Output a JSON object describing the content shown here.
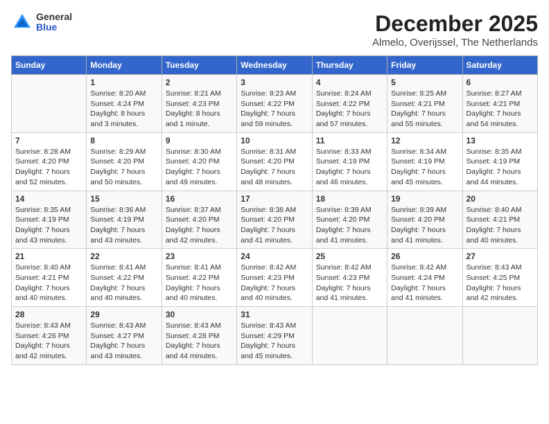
{
  "header": {
    "logo": {
      "general": "General",
      "blue": "Blue"
    },
    "title": "December 2025",
    "subtitle": "Almelo, Overijssel, The Netherlands"
  },
  "calendar": {
    "weekdays": [
      "Sunday",
      "Monday",
      "Tuesday",
      "Wednesday",
      "Thursday",
      "Friday",
      "Saturday"
    ],
    "weeks": [
      [
        {
          "day": "",
          "detail": ""
        },
        {
          "day": "1",
          "detail": "Sunrise: 8:20 AM\nSunset: 4:24 PM\nDaylight: 8 hours\nand 3 minutes."
        },
        {
          "day": "2",
          "detail": "Sunrise: 8:21 AM\nSunset: 4:23 PM\nDaylight: 8 hours\nand 1 minute."
        },
        {
          "day": "3",
          "detail": "Sunrise: 8:23 AM\nSunset: 4:22 PM\nDaylight: 7 hours\nand 59 minutes."
        },
        {
          "day": "4",
          "detail": "Sunrise: 8:24 AM\nSunset: 4:22 PM\nDaylight: 7 hours\nand 57 minutes."
        },
        {
          "day": "5",
          "detail": "Sunrise: 8:25 AM\nSunset: 4:21 PM\nDaylight: 7 hours\nand 55 minutes."
        },
        {
          "day": "6",
          "detail": "Sunrise: 8:27 AM\nSunset: 4:21 PM\nDaylight: 7 hours\nand 54 minutes."
        }
      ],
      [
        {
          "day": "7",
          "detail": "Sunrise: 8:28 AM\nSunset: 4:20 PM\nDaylight: 7 hours\nand 52 minutes."
        },
        {
          "day": "8",
          "detail": "Sunrise: 8:29 AM\nSunset: 4:20 PM\nDaylight: 7 hours\nand 50 minutes."
        },
        {
          "day": "9",
          "detail": "Sunrise: 8:30 AM\nSunset: 4:20 PM\nDaylight: 7 hours\nand 49 minutes."
        },
        {
          "day": "10",
          "detail": "Sunrise: 8:31 AM\nSunset: 4:20 PM\nDaylight: 7 hours\nand 48 minutes."
        },
        {
          "day": "11",
          "detail": "Sunrise: 8:33 AM\nSunset: 4:19 PM\nDaylight: 7 hours\nand 46 minutes."
        },
        {
          "day": "12",
          "detail": "Sunrise: 8:34 AM\nSunset: 4:19 PM\nDaylight: 7 hours\nand 45 minutes."
        },
        {
          "day": "13",
          "detail": "Sunrise: 8:35 AM\nSunset: 4:19 PM\nDaylight: 7 hours\nand 44 minutes."
        }
      ],
      [
        {
          "day": "14",
          "detail": "Sunrise: 8:35 AM\nSunset: 4:19 PM\nDaylight: 7 hours\nand 43 minutes."
        },
        {
          "day": "15",
          "detail": "Sunrise: 8:36 AM\nSunset: 4:19 PM\nDaylight: 7 hours\nand 43 minutes."
        },
        {
          "day": "16",
          "detail": "Sunrise: 8:37 AM\nSunset: 4:20 PM\nDaylight: 7 hours\nand 42 minutes."
        },
        {
          "day": "17",
          "detail": "Sunrise: 8:38 AM\nSunset: 4:20 PM\nDaylight: 7 hours\nand 41 minutes."
        },
        {
          "day": "18",
          "detail": "Sunrise: 8:39 AM\nSunset: 4:20 PM\nDaylight: 7 hours\nand 41 minutes."
        },
        {
          "day": "19",
          "detail": "Sunrise: 8:39 AM\nSunset: 4:20 PM\nDaylight: 7 hours\nand 41 minutes."
        },
        {
          "day": "20",
          "detail": "Sunrise: 8:40 AM\nSunset: 4:21 PM\nDaylight: 7 hours\nand 40 minutes."
        }
      ],
      [
        {
          "day": "21",
          "detail": "Sunrise: 8:40 AM\nSunset: 4:21 PM\nDaylight: 7 hours\nand 40 minutes."
        },
        {
          "day": "22",
          "detail": "Sunrise: 8:41 AM\nSunset: 4:22 PM\nDaylight: 7 hours\nand 40 minutes."
        },
        {
          "day": "23",
          "detail": "Sunrise: 8:41 AM\nSunset: 4:22 PM\nDaylight: 7 hours\nand 40 minutes."
        },
        {
          "day": "24",
          "detail": "Sunrise: 8:42 AM\nSunset: 4:23 PM\nDaylight: 7 hours\nand 40 minutes."
        },
        {
          "day": "25",
          "detail": "Sunrise: 8:42 AM\nSunset: 4:23 PM\nDaylight: 7 hours\nand 41 minutes."
        },
        {
          "day": "26",
          "detail": "Sunrise: 8:42 AM\nSunset: 4:24 PM\nDaylight: 7 hours\nand 41 minutes."
        },
        {
          "day": "27",
          "detail": "Sunrise: 8:43 AM\nSunset: 4:25 PM\nDaylight: 7 hours\nand 42 minutes."
        }
      ],
      [
        {
          "day": "28",
          "detail": "Sunrise: 8:43 AM\nSunset: 4:26 PM\nDaylight: 7 hours\nand 42 minutes."
        },
        {
          "day": "29",
          "detail": "Sunrise: 8:43 AM\nSunset: 4:27 PM\nDaylight: 7 hours\nand 43 minutes."
        },
        {
          "day": "30",
          "detail": "Sunrise: 8:43 AM\nSunset: 4:28 PM\nDaylight: 7 hours\nand 44 minutes."
        },
        {
          "day": "31",
          "detail": "Sunrise: 8:43 AM\nSunset: 4:29 PM\nDaylight: 7 hours\nand 45 minutes."
        },
        {
          "day": "",
          "detail": ""
        },
        {
          "day": "",
          "detail": ""
        },
        {
          "day": "",
          "detail": ""
        }
      ]
    ]
  }
}
